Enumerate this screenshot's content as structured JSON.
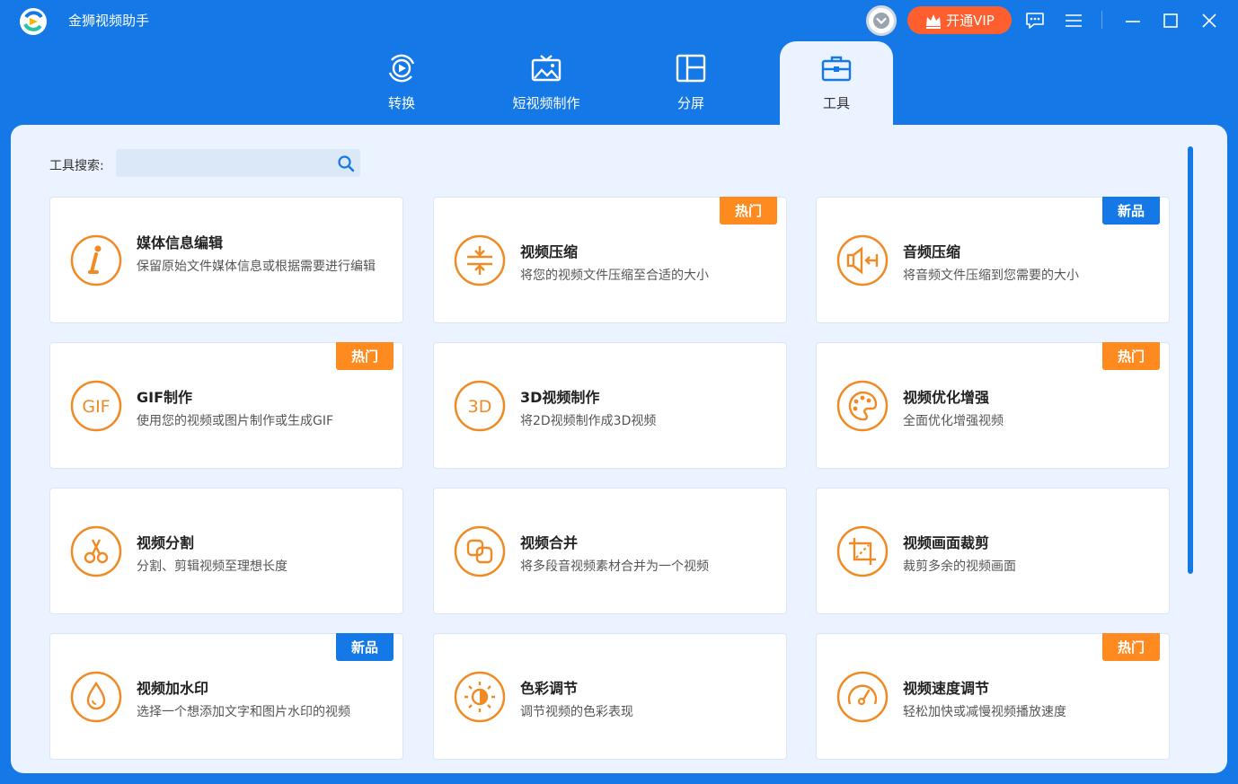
{
  "app": {
    "title": "金狮视频助手"
  },
  "header": {
    "vip_label": "开通VIP"
  },
  "tabs": [
    {
      "label": "转换"
    },
    {
      "label": "短视频制作"
    },
    {
      "label": "分屏"
    },
    {
      "label": "工具"
    }
  ],
  "search": {
    "label": "工具搜索:",
    "value": "",
    "placeholder": ""
  },
  "tools": [
    {
      "title": "媒体信息编辑",
      "desc": "保留原始文件媒体信息或根据需要进行编辑",
      "badge": "",
      "icon": "info-icon"
    },
    {
      "title": "视频压缩",
      "desc": "将您的视频文件压缩至合适的大小",
      "badge": "热门",
      "icon": "compress-icon"
    },
    {
      "title": "音频压缩",
      "desc": "将音频文件压缩到您需要的大小",
      "badge": "新品",
      "icon": "audio-compress-icon"
    },
    {
      "title": "GIF制作",
      "desc": "使用您的视频或图片制作或生成GIF",
      "badge": "热门",
      "icon": "gif-icon"
    },
    {
      "title": "3D视频制作",
      "desc": "将2D视频制作成3D视频",
      "badge": "",
      "icon": "3d-icon"
    },
    {
      "title": "视频优化增强",
      "desc": "全面优化增强视频",
      "badge": "热门",
      "icon": "palette-icon"
    },
    {
      "title": "视频分割",
      "desc": "分割、剪辑视频至理想长度",
      "badge": "",
      "icon": "scissors-icon"
    },
    {
      "title": "视频合并",
      "desc": "将多段音视频素材合并为一个视频",
      "badge": "",
      "icon": "merge-icon"
    },
    {
      "title": "视频画面裁剪",
      "desc": "裁剪多余的视频画面",
      "badge": "",
      "icon": "crop-icon"
    },
    {
      "title": "视频加水印",
      "desc": "选择一个想添加文字和图片水印的视频",
      "badge": "新品",
      "icon": "drop-icon"
    },
    {
      "title": "色彩调节",
      "desc": "调节视频的色彩表现",
      "badge": "",
      "icon": "color-icon"
    },
    {
      "title": "视频速度调节",
      "desc": "轻松加快或减慢视频播放速度",
      "badge": "热门",
      "icon": "speed-icon"
    }
  ],
  "colors": {
    "brand": "#1479e6",
    "accent": "#f08a24",
    "hot": "#ff8a1f",
    "new": "#1479e6",
    "vip": "#ff5f2e"
  }
}
